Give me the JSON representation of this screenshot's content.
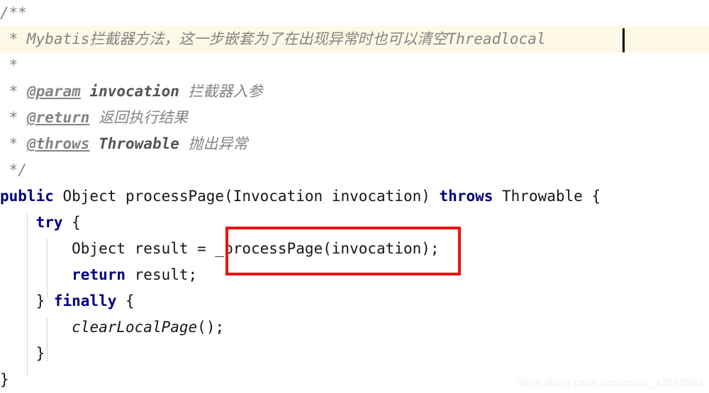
{
  "editor": {
    "background_color": "#ffffff",
    "keyword_color": "#000080",
    "comment_color": "#838383",
    "highlight_line_color": "#fdf9e6",
    "annotation_color": "#ee1111",
    "caret_color": "#000000",
    "font_size_px": 21,
    "line_height_px": 37
  },
  "code": {
    "language": "java",
    "lines": [
      {
        "index": 1,
        "highlighted": false,
        "segments": [
          {
            "style": "cmt",
            "text": "/**"
          }
        ]
      },
      {
        "index": 2,
        "highlighted": true,
        "segments": [
          {
            "style": "cmt",
            "text": " * Mybatis拦截器方法，这一步嵌套为了在出现异常时也可以清空Threadlocal"
          }
        ]
      },
      {
        "index": 3,
        "highlighted": false,
        "segments": [
          {
            "style": "cmt",
            "text": " *"
          }
        ]
      },
      {
        "index": 4,
        "highlighted": false,
        "segments": [
          {
            "style": "cmt",
            "text": " * "
          },
          {
            "style": "cmt-tag",
            "text": "@param"
          },
          {
            "style": "cmt",
            "text": " "
          },
          {
            "style": "cmt-code",
            "text": "invocation"
          },
          {
            "style": "cmt",
            "text": " 拦截器入参"
          }
        ]
      },
      {
        "index": 5,
        "highlighted": false,
        "segments": [
          {
            "style": "cmt",
            "text": " * "
          },
          {
            "style": "cmt-tag",
            "text": "@return"
          },
          {
            "style": "cmt",
            "text": " 返回执行结果"
          }
        ]
      },
      {
        "index": 6,
        "highlighted": false,
        "segments": [
          {
            "style": "cmt",
            "text": " * "
          },
          {
            "style": "cmt-tag",
            "text": "@throws"
          },
          {
            "style": "cmt",
            "text": " "
          },
          {
            "style": "cmt-code",
            "text": "Throwable"
          },
          {
            "style": "cmt",
            "text": " 抛出异常"
          }
        ]
      },
      {
        "index": 7,
        "highlighted": false,
        "segments": [
          {
            "style": "cmt",
            "text": " */"
          }
        ]
      },
      {
        "index": 8,
        "highlighted": false,
        "segments": [
          {
            "style": "kw",
            "text": "public"
          },
          {
            "style": "plain",
            "text": " Object processPage(Invocation invocation) "
          },
          {
            "style": "kw",
            "text": "throws"
          },
          {
            "style": "plain",
            "text": " Throwable {"
          }
        ]
      },
      {
        "index": 9,
        "highlighted": false,
        "segments": [
          {
            "style": "plain",
            "text": "    "
          },
          {
            "style": "kw",
            "text": "try"
          },
          {
            "style": "plain",
            "text": " {"
          }
        ]
      },
      {
        "index": 10,
        "highlighted": false,
        "segments": [
          {
            "style": "plain",
            "text": "        Object result = _processPage(invocation);"
          }
        ]
      },
      {
        "index": 11,
        "highlighted": false,
        "segments": [
          {
            "style": "plain",
            "text": "        "
          },
          {
            "style": "kw",
            "text": "return"
          },
          {
            "style": "plain",
            "text": " result;"
          }
        ]
      },
      {
        "index": 12,
        "highlighted": false,
        "segments": [
          {
            "style": "plain",
            "text": "    } "
          },
          {
            "style": "kw",
            "text": "finally"
          },
          {
            "style": "plain",
            "text": " {"
          }
        ]
      },
      {
        "index": 13,
        "highlighted": false,
        "segments": [
          {
            "style": "plain",
            "text": "        "
          },
          {
            "style": "ital",
            "text": "clearLocalPage"
          },
          {
            "style": "plain",
            "text": "();"
          }
        ]
      },
      {
        "index": 14,
        "highlighted": false,
        "segments": [
          {
            "style": "plain",
            "text": "    }"
          }
        ]
      },
      {
        "index": 15,
        "highlighted": false,
        "segments": [
          {
            "style": "plain",
            "text": "}"
          }
        ]
      }
    ]
  },
  "annotation": {
    "label": "_processPage(invocation);",
    "color": "#ee1111"
  },
  "caret": {
    "line": 2,
    "after_text": "Threadlocal"
  },
  "watermark": {
    "text": "https://blog.csdn.net/weixin_43525993"
  }
}
